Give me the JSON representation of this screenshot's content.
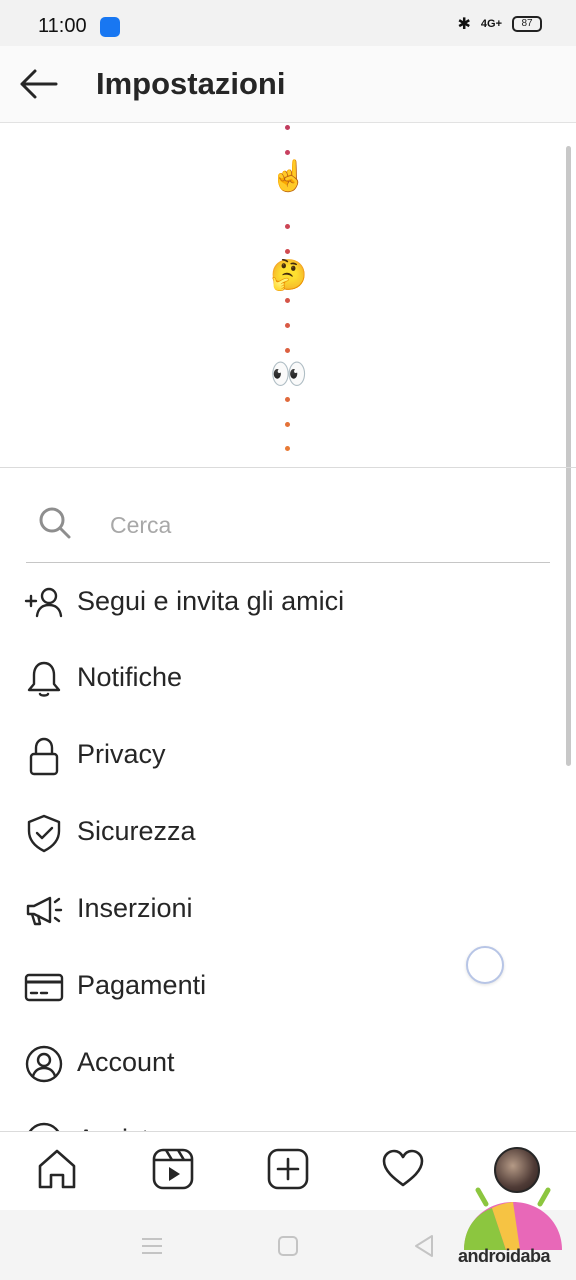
{
  "status_bar": {
    "time": "11:00",
    "network": "4G+",
    "battery": "87"
  },
  "header": {
    "title": "Impostazioni"
  },
  "search": {
    "placeholder": "Cerca"
  },
  "menu": [
    {
      "label": "Segui e invita gli amici",
      "icon": "add-person-icon"
    },
    {
      "label": "Notifiche",
      "icon": "bell-icon"
    },
    {
      "label": "Privacy",
      "icon": "lock-icon"
    },
    {
      "label": "Sicurezza",
      "icon": "shield-check-icon"
    },
    {
      "label": "Inserzioni",
      "icon": "megaphone-icon"
    },
    {
      "label": "Pagamenti",
      "icon": "credit-card-icon"
    },
    {
      "label": "Account",
      "icon": "account-icon"
    },
    {
      "label": "Assistenza",
      "icon": "help-icon"
    }
  ],
  "bottom_nav": [
    "home-icon",
    "reels-icon",
    "new-post-icon",
    "activity-heart-icon",
    "profile-avatar"
  ],
  "story_emojis": [
    "☝️",
    "🤔",
    "👀"
  ],
  "watermark": {
    "text": "androidaba"
  },
  "colors": {
    "text": "#262626",
    "placeholder": "#a8a8a8",
    "divider": "#dbdbdb"
  }
}
